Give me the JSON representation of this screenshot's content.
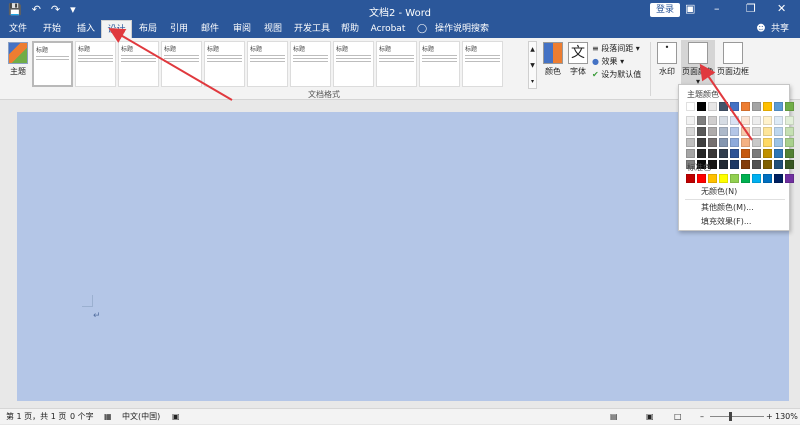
{
  "titlebar": {
    "title": "文档2 - Word",
    "login_label": "登录",
    "quick_access": [
      "save-icon",
      "undo-icon",
      "redo-icon",
      "customize-icon"
    ]
  },
  "menu": {
    "tabs": [
      {
        "label": "文件"
      },
      {
        "label": "开始"
      },
      {
        "label": "插入"
      },
      {
        "label": "设计"
      },
      {
        "label": "布局"
      },
      {
        "label": "引用"
      },
      {
        "label": "邮件"
      },
      {
        "label": "审阅"
      },
      {
        "label": "视图"
      },
      {
        "label": "开发工具"
      },
      {
        "label": "帮助"
      },
      {
        "label": "Acrobat"
      }
    ],
    "active_tab": "设计",
    "tell_me": "操作说明搜索",
    "share": "共享"
  },
  "ribbon": {
    "theme_label": "主题",
    "style_thumbs": [
      "标题",
      "标题",
      "标题",
      "标题",
      "标题",
      "标题",
      "标题",
      "标题",
      "标题",
      "标题",
      "标题",
      "标题"
    ],
    "group_label": "文档格式",
    "colors_label": "颜色",
    "fonts_label": "字体",
    "paragraph_spacing": "段落间距",
    "effects": "效果",
    "set_default": "设为默认值",
    "watermark": "水印",
    "page_color": "页面颜色",
    "page_border": "页面边框"
  },
  "dropdown": {
    "theme_colors_title": "主题颜色",
    "standard_colors_title": "标准色",
    "no_color": "无颜色(N)",
    "more_colors": "其他颜色(M)...",
    "fill_effects": "填充效果(F)...",
    "theme_top": [
      "#ffffff",
      "#000000",
      "#e7e6e6",
      "#44546a",
      "#4472c4",
      "#ed7d31",
      "#a5a5a5",
      "#ffc000",
      "#5b9bd5",
      "#70ad47"
    ],
    "theme_shades": [
      [
        "#f2f2f2",
        "#7f7f7f",
        "#d0cece",
        "#d6dce4",
        "#d9e2f3",
        "#fbe5d5",
        "#ededed",
        "#fff2cc",
        "#deebf6",
        "#e2efd9"
      ],
      [
        "#d8d8d8",
        "#595959",
        "#aeabab",
        "#adb9ca",
        "#b4c6e7",
        "#f7cbac",
        "#dbdbdb",
        "#fee599",
        "#bdd7ee",
        "#c5e0b3"
      ],
      [
        "#bfbfbf",
        "#3f3f3f",
        "#757070",
        "#8496b0",
        "#8eaadb",
        "#f4b183",
        "#c9c9c9",
        "#ffd965",
        "#9cc3e5",
        "#a8d08d"
      ],
      [
        "#a5a5a5",
        "#262626",
        "#3a3838",
        "#323f4f",
        "#2f5496",
        "#c55a11",
        "#7b7b7b",
        "#bf9000",
        "#2e75b5",
        "#538135"
      ],
      [
        "#7f7f7f",
        "#0c0c0c",
        "#171616",
        "#222a35",
        "#1e3864",
        "#833c0b",
        "#525252",
        "#7f6000",
        "#1f4e79",
        "#375623"
      ]
    ],
    "standard": [
      "#c00000",
      "#ff0000",
      "#ffc000",
      "#ffff00",
      "#92d050",
      "#00b050",
      "#00b0f0",
      "#0070c0",
      "#002060",
      "#7030a0"
    ]
  },
  "page": {
    "background": "#b4c6e7"
  },
  "statusbar": {
    "page_info": "第 1 页，共 1 页",
    "word_count": "0 个字",
    "language": "中文(中国)",
    "zoom": "130%"
  },
  "colors": {
    "accent": "#2b579a",
    "annotation_arrow": "#e0393e"
  }
}
